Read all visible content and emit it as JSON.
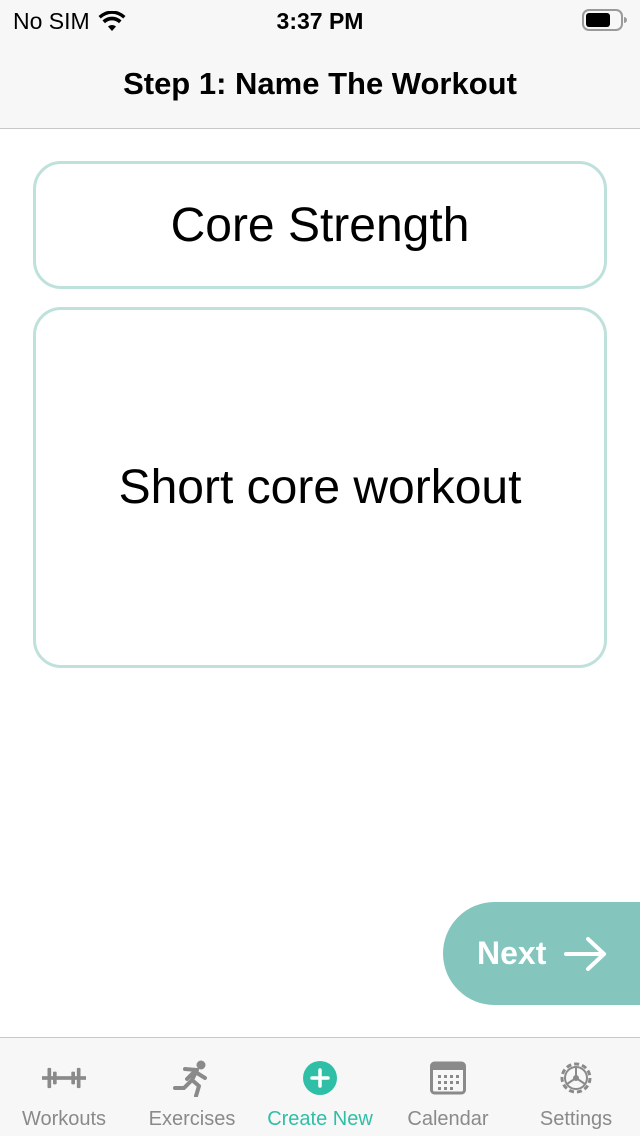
{
  "status_bar": {
    "carrier": "No SIM",
    "time": "3:37 PM"
  },
  "nav": {
    "title": "Step 1: Name The Workout"
  },
  "form": {
    "name_value": "Core Strength",
    "description_value": "Short core workout"
  },
  "next_button": {
    "label": "Next",
    "icon": "arrow-right-icon"
  },
  "tab_bar": {
    "active_color": "#2fbfa6",
    "inactive_color": "#8a8a8a",
    "items": [
      {
        "label": "Workouts",
        "icon": "dumbbell-icon"
      },
      {
        "label": "Exercises",
        "icon": "running-icon"
      },
      {
        "label": "Create New",
        "icon": "plus-circle-icon",
        "active": true
      },
      {
        "label": "Calendar",
        "icon": "calendar-icon"
      },
      {
        "label": "Settings",
        "icon": "gear-icon"
      }
    ]
  },
  "colors": {
    "field_border": "#bfe1dc",
    "button_bg": "#84c6bd"
  }
}
